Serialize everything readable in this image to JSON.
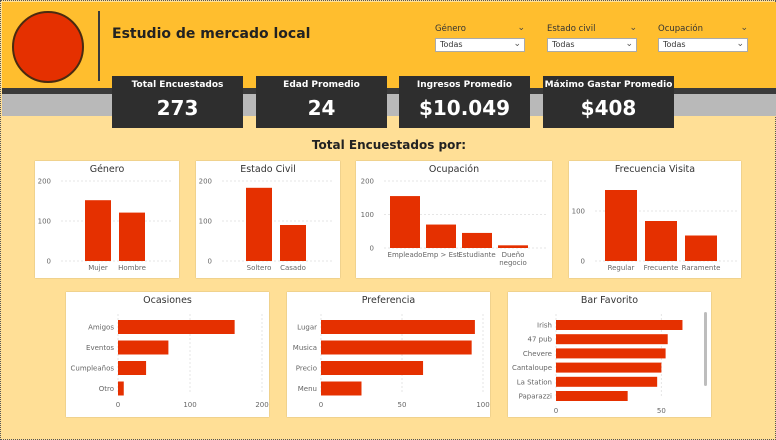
{
  "header": {
    "title": "Estudio de mercado local",
    "filters": [
      {
        "label": "Género",
        "value": "Todas"
      },
      {
        "label": "Estado civil",
        "value": "Todas"
      },
      {
        "label": "Ocupación",
        "value": "Todas"
      }
    ]
  },
  "kpis": [
    {
      "label": "Total Encuestados",
      "value": "273"
    },
    {
      "label": "Edad Promedio",
      "value": "24"
    },
    {
      "label": "Ingresos Promedio",
      "value": "$10.049"
    },
    {
      "label": "Máximo Gastar Promedio",
      "value": "$408"
    }
  ],
  "section_title": "Total Encuestados por:",
  "colors": {
    "bar": "#e53000",
    "header": "#ffbe2e",
    "background": "#ffdf96",
    "kpi_bg": "#2e2e2e"
  },
  "chart_data": [
    {
      "id": "genero",
      "type": "bar",
      "title": "Género",
      "categories": [
        "Mujer",
        "Hombre"
      ],
      "values": [
        152,
        121
      ],
      "ylim": [
        0,
        200
      ],
      "yticks": [
        0,
        100,
        200
      ]
    },
    {
      "id": "estado",
      "type": "bar",
      "title": "Estado Civil",
      "categories": [
        "Soltero",
        "Casado"
      ],
      "values": [
        183,
        90
      ],
      "ylim": [
        0,
        200
      ],
      "yticks": [
        0,
        100,
        200
      ]
    },
    {
      "id": "ocupacion",
      "type": "bar",
      "title": "Ocupación",
      "categories": [
        "Empleado",
        "Emp > Est",
        "Estudiante",
        "Dueño negocio"
      ],
      "values": [
        155,
        70,
        45,
        8
      ],
      "ylim": [
        0,
        200
      ],
      "yticks": [
        0,
        100,
        200
      ]
    },
    {
      "id": "frecuencia",
      "type": "bar",
      "title": "Frecuencia Visita",
      "categories": [
        "Regular",
        "Frecuente",
        "Raramente"
      ],
      "values": [
        142,
        80,
        51
      ],
      "ylim": [
        0,
        160
      ],
      "yticks": [
        0,
        100
      ]
    },
    {
      "id": "ocasiones",
      "type": "hbar",
      "title": "Ocasiones",
      "categories": [
        "Amigos",
        "Eventos",
        "Cumpleaños",
        "Otro"
      ],
      "values": [
        162,
        70,
        39,
        8
      ],
      "xlim": [
        0,
        200
      ],
      "xticks": [
        0,
        100,
        200
      ]
    },
    {
      "id": "preferencia",
      "type": "hbar",
      "title": "Preferencia",
      "categories": [
        "Lugar",
        "Musica",
        "Precio",
        "Menu"
      ],
      "values": [
        95,
        93,
        63,
        25
      ],
      "xlim": [
        0,
        100
      ],
      "xticks": [
        0,
        50,
        100
      ]
    },
    {
      "id": "bar",
      "type": "hbar",
      "title": "Bar Favorito",
      "categories": [
        "Irish",
        "47 pub",
        "Chevere",
        "Cantaloupe",
        "La Station",
        "Paparazzi"
      ],
      "values": [
        60,
        53,
        52,
        50,
        48,
        34
      ],
      "xlim": [
        0,
        65
      ],
      "xticks": [
        0,
        50
      ]
    }
  ]
}
